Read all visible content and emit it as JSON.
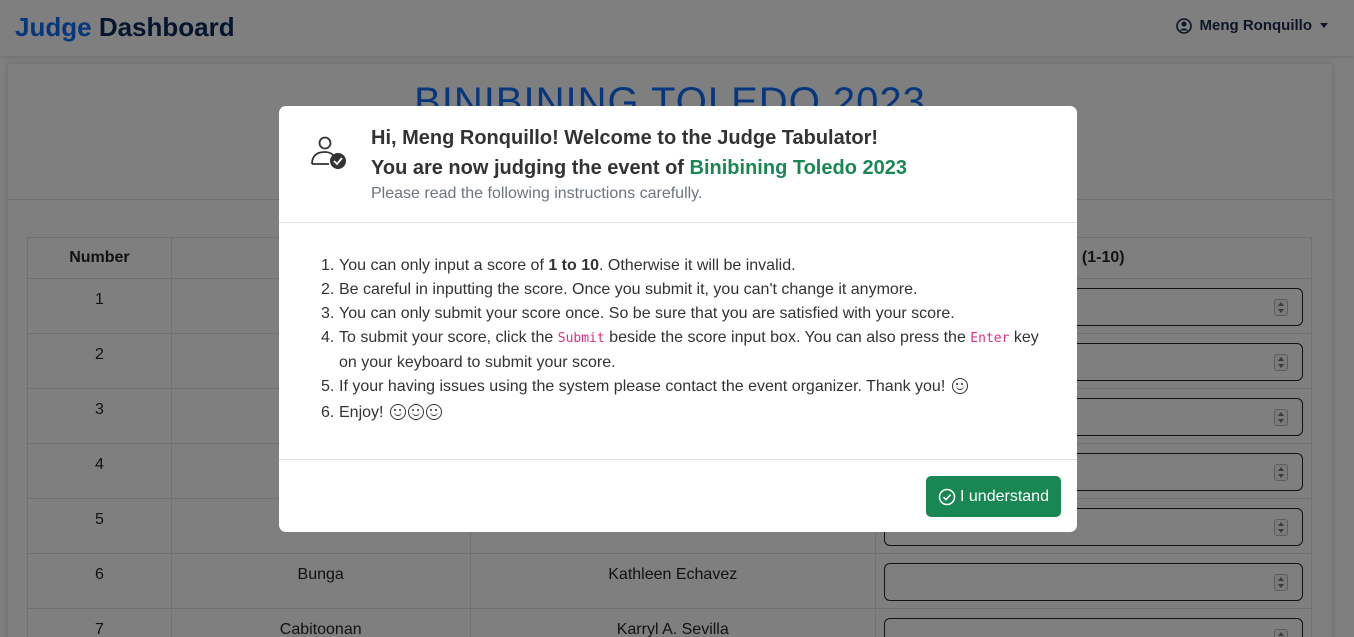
{
  "navbar": {
    "brand_part1": "Judge",
    "brand_part2": "Dashboard",
    "user_name": "Meng Ronquillo"
  },
  "page": {
    "event_title": "BINIBINING TOLEDO 2023"
  },
  "table": {
    "headers": [
      "Number",
      "",
      "",
      "re (1-10)"
    ],
    "rows": [
      {
        "number": "1",
        "barangay": "",
        "name": ""
      },
      {
        "number": "2",
        "barangay": "",
        "name": ""
      },
      {
        "number": "3",
        "barangay": "",
        "name": ""
      },
      {
        "number": "4",
        "barangay": "",
        "name": ""
      },
      {
        "number": "5",
        "barangay": "",
        "name": ""
      },
      {
        "number": "6",
        "barangay": "Bunga",
        "name": "Kathleen Echavez"
      },
      {
        "number": "7",
        "barangay": "Cabitoonan",
        "name": "Karryl A. Sevilla"
      }
    ]
  },
  "modal": {
    "greeting": "Hi, Meng Ronquillo! Welcome to the Judge Tabulator!",
    "judging_prefix": "You are now judging the event of ",
    "event_name": "Binibining Toledo 2023",
    "subtitle": "Please read the following instructions carefully.",
    "instructions": {
      "i1_pre": "You can only input a score of ",
      "i1_bold": "1 to 10",
      "i1_post": ". Otherwise it will be invalid.",
      "i2": "Be careful in inputting the score. Once you submit it, you can't change it anymore.",
      "i3": "You can only submit your score once. So be sure that you are satisfied with your score.",
      "i4_pre": "To submit your score, click the ",
      "i4_code1": "Submit",
      "i4_mid": " beside the score input box. You can also press the ",
      "i4_code2": "Enter",
      "i4_post": " key on your keyboard to submit your score.",
      "i5": "If your having issues using the system please contact the event organizer. Thank you!",
      "i6": "Enjoy!"
    },
    "button_label": "I understand",
    "colors": {
      "accent_green": "#198754",
      "brand_blue": "#0d6efd"
    }
  }
}
